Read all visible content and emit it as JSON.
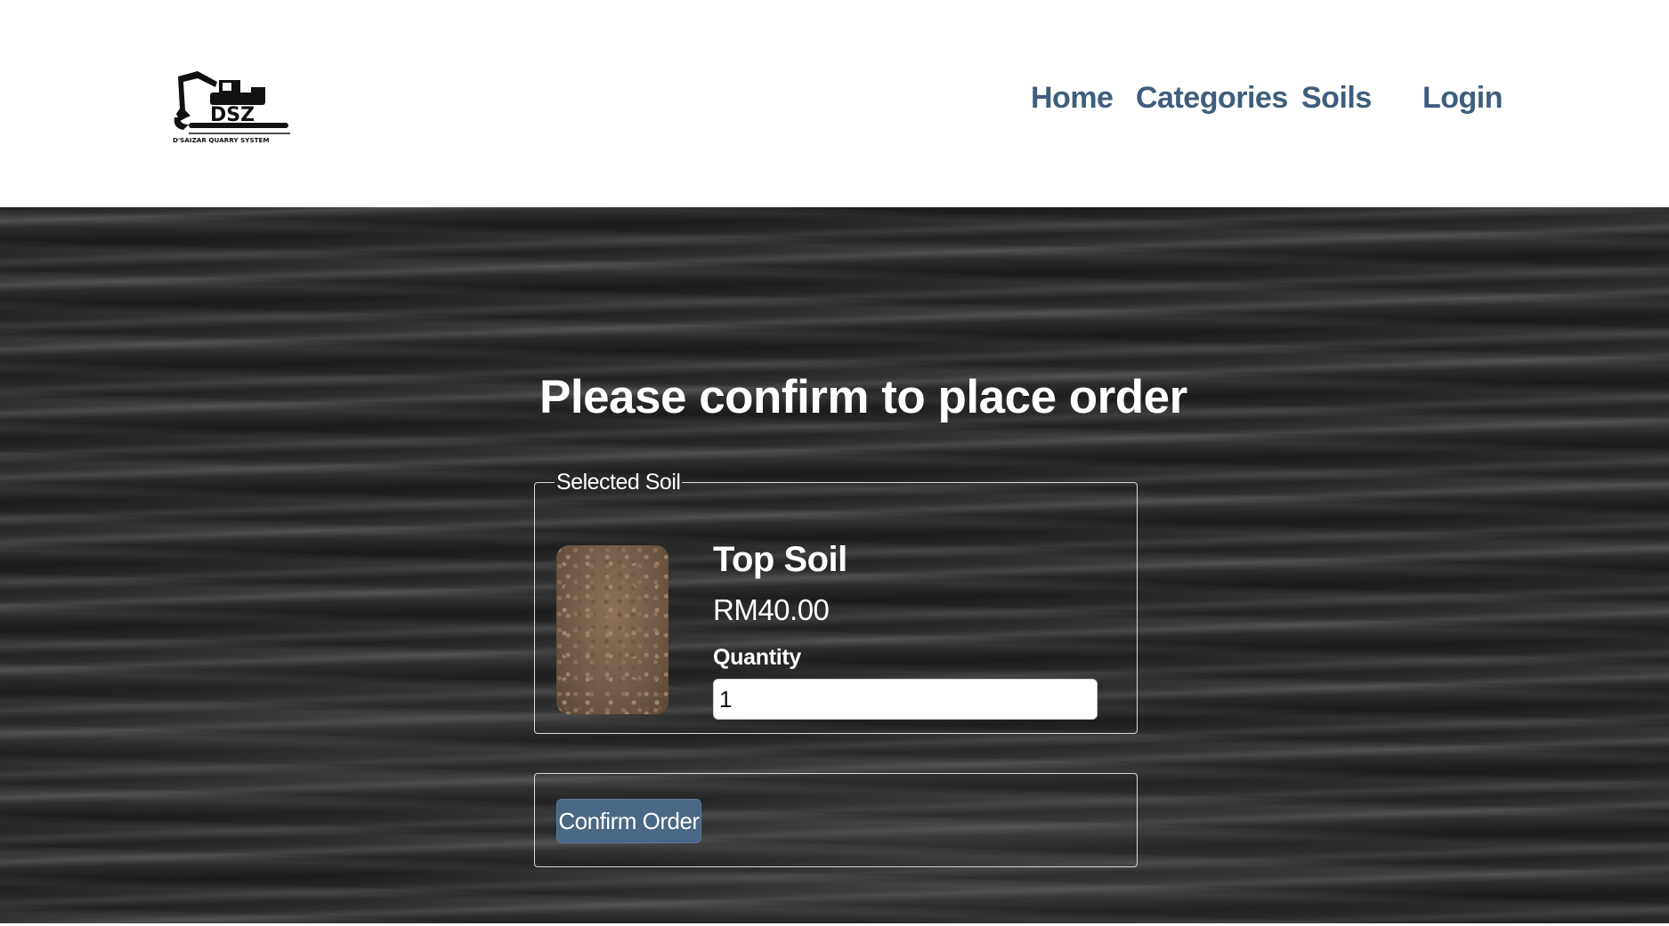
{
  "header": {
    "logo": {
      "text": "DSZ",
      "subtitle": "D'SAIZAR QUARRY SYSTEM",
      "icon": "excavator-icon"
    },
    "nav": [
      {
        "label": "Home"
      },
      {
        "label": "Categories"
      },
      {
        "label": "Soils"
      },
      {
        "label": "Login"
      }
    ]
  },
  "main": {
    "title": "Please confirm to place order",
    "selected_soil": {
      "legend": "Selected Soil",
      "name": "Top Soil",
      "price": "RM40.00",
      "quantity_label": "Quantity",
      "quantity_value": "1"
    },
    "confirm_label": "Confirm Order"
  },
  "colors": {
    "nav_link": "#3f5e7e",
    "button_bg": "#4a6785",
    "hero_bg": "#222222"
  }
}
